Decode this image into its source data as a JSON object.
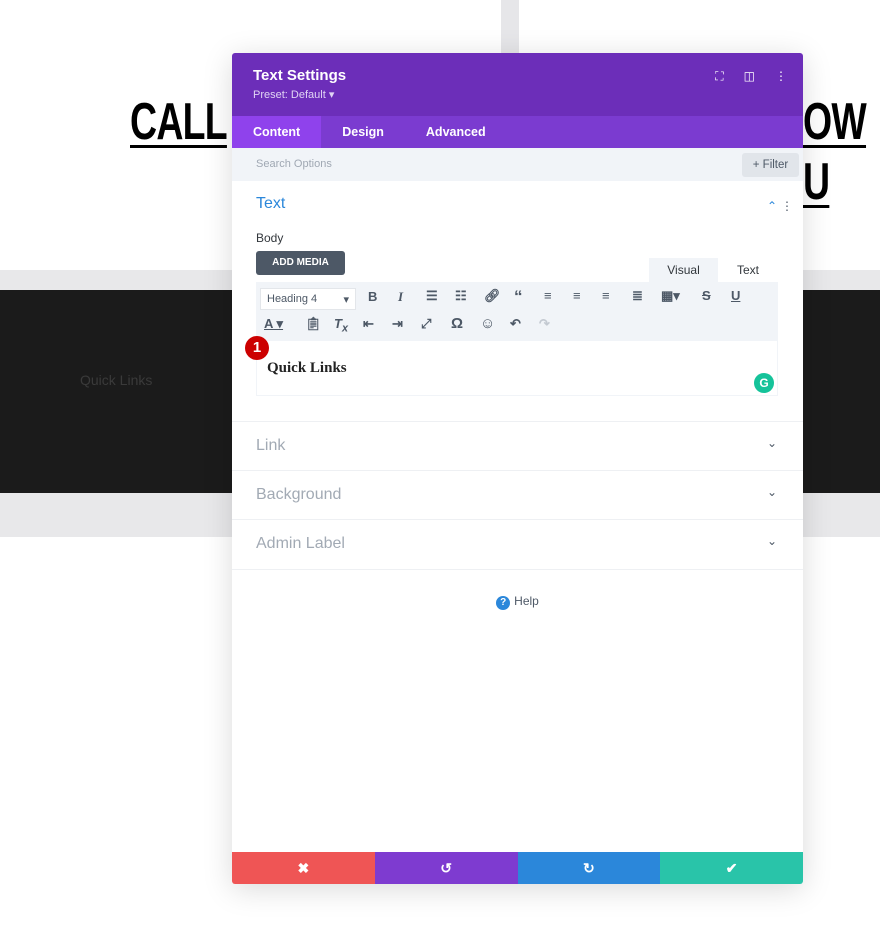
{
  "background": {
    "heading_left": "CALL",
    "heading_right": "OW U",
    "footer_text": "Quick Links"
  },
  "modal": {
    "title": "Text Settings",
    "preset": "Preset: Default ▾",
    "icons": [
      "fullscreen-icon",
      "split-view-icon",
      "more-icon"
    ],
    "tabs": [
      {
        "label": "Content",
        "active": true
      },
      {
        "label": "Design"
      },
      {
        "label": "Advanced"
      }
    ],
    "search_placeholder": "Search Options",
    "filter_label": "+ Filter",
    "text_section": {
      "title": "Text",
      "body_label": "Body",
      "add_media": "ADD MEDIA",
      "visual_tab": "Visual",
      "text_tab": "Text",
      "format_select": "Heading 4",
      "content": "Quick Links",
      "badge": "1"
    },
    "sections": [
      "Link",
      "Background",
      "Admin Label"
    ],
    "help": "Help",
    "footer_colors": {
      "cancel": "#ef5555",
      "undo": "#7e3bd0",
      "redo": "#2b87da",
      "save": "#29c4a9"
    }
  }
}
